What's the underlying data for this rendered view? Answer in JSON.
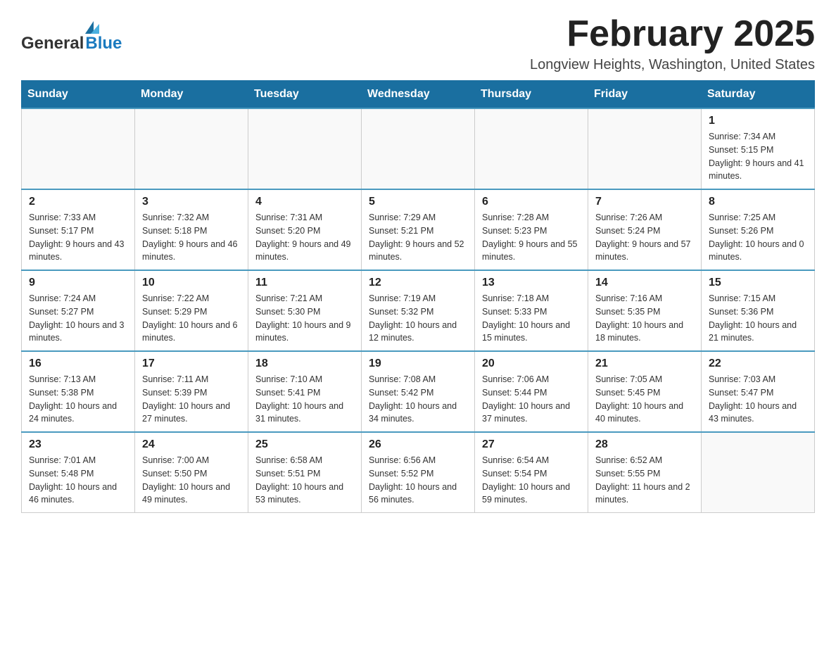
{
  "header": {
    "logo_general": "General",
    "logo_blue": "Blue",
    "month_title": "February 2025",
    "location": "Longview Heights, Washington, United States"
  },
  "calendar": {
    "days_of_week": [
      "Sunday",
      "Monday",
      "Tuesday",
      "Wednesday",
      "Thursday",
      "Friday",
      "Saturday"
    ],
    "weeks": [
      [
        {
          "day": "",
          "info": ""
        },
        {
          "day": "",
          "info": ""
        },
        {
          "day": "",
          "info": ""
        },
        {
          "day": "",
          "info": ""
        },
        {
          "day": "",
          "info": ""
        },
        {
          "day": "",
          "info": ""
        },
        {
          "day": "1",
          "info": "Sunrise: 7:34 AM\nSunset: 5:15 PM\nDaylight: 9 hours and 41 minutes."
        }
      ],
      [
        {
          "day": "2",
          "info": "Sunrise: 7:33 AM\nSunset: 5:17 PM\nDaylight: 9 hours and 43 minutes."
        },
        {
          "day": "3",
          "info": "Sunrise: 7:32 AM\nSunset: 5:18 PM\nDaylight: 9 hours and 46 minutes."
        },
        {
          "day": "4",
          "info": "Sunrise: 7:31 AM\nSunset: 5:20 PM\nDaylight: 9 hours and 49 minutes."
        },
        {
          "day": "5",
          "info": "Sunrise: 7:29 AM\nSunset: 5:21 PM\nDaylight: 9 hours and 52 minutes."
        },
        {
          "day": "6",
          "info": "Sunrise: 7:28 AM\nSunset: 5:23 PM\nDaylight: 9 hours and 55 minutes."
        },
        {
          "day": "7",
          "info": "Sunrise: 7:26 AM\nSunset: 5:24 PM\nDaylight: 9 hours and 57 minutes."
        },
        {
          "day": "8",
          "info": "Sunrise: 7:25 AM\nSunset: 5:26 PM\nDaylight: 10 hours and 0 minutes."
        }
      ],
      [
        {
          "day": "9",
          "info": "Sunrise: 7:24 AM\nSunset: 5:27 PM\nDaylight: 10 hours and 3 minutes."
        },
        {
          "day": "10",
          "info": "Sunrise: 7:22 AM\nSunset: 5:29 PM\nDaylight: 10 hours and 6 minutes."
        },
        {
          "day": "11",
          "info": "Sunrise: 7:21 AM\nSunset: 5:30 PM\nDaylight: 10 hours and 9 minutes."
        },
        {
          "day": "12",
          "info": "Sunrise: 7:19 AM\nSunset: 5:32 PM\nDaylight: 10 hours and 12 minutes."
        },
        {
          "day": "13",
          "info": "Sunrise: 7:18 AM\nSunset: 5:33 PM\nDaylight: 10 hours and 15 minutes."
        },
        {
          "day": "14",
          "info": "Sunrise: 7:16 AM\nSunset: 5:35 PM\nDaylight: 10 hours and 18 minutes."
        },
        {
          "day": "15",
          "info": "Sunrise: 7:15 AM\nSunset: 5:36 PM\nDaylight: 10 hours and 21 minutes."
        }
      ],
      [
        {
          "day": "16",
          "info": "Sunrise: 7:13 AM\nSunset: 5:38 PM\nDaylight: 10 hours and 24 minutes."
        },
        {
          "day": "17",
          "info": "Sunrise: 7:11 AM\nSunset: 5:39 PM\nDaylight: 10 hours and 27 minutes."
        },
        {
          "day": "18",
          "info": "Sunrise: 7:10 AM\nSunset: 5:41 PM\nDaylight: 10 hours and 31 minutes."
        },
        {
          "day": "19",
          "info": "Sunrise: 7:08 AM\nSunset: 5:42 PM\nDaylight: 10 hours and 34 minutes."
        },
        {
          "day": "20",
          "info": "Sunrise: 7:06 AM\nSunset: 5:44 PM\nDaylight: 10 hours and 37 minutes."
        },
        {
          "day": "21",
          "info": "Sunrise: 7:05 AM\nSunset: 5:45 PM\nDaylight: 10 hours and 40 minutes."
        },
        {
          "day": "22",
          "info": "Sunrise: 7:03 AM\nSunset: 5:47 PM\nDaylight: 10 hours and 43 minutes."
        }
      ],
      [
        {
          "day": "23",
          "info": "Sunrise: 7:01 AM\nSunset: 5:48 PM\nDaylight: 10 hours and 46 minutes."
        },
        {
          "day": "24",
          "info": "Sunrise: 7:00 AM\nSunset: 5:50 PM\nDaylight: 10 hours and 49 minutes."
        },
        {
          "day": "25",
          "info": "Sunrise: 6:58 AM\nSunset: 5:51 PM\nDaylight: 10 hours and 53 minutes."
        },
        {
          "day": "26",
          "info": "Sunrise: 6:56 AM\nSunset: 5:52 PM\nDaylight: 10 hours and 56 minutes."
        },
        {
          "day": "27",
          "info": "Sunrise: 6:54 AM\nSunset: 5:54 PM\nDaylight: 10 hours and 59 minutes."
        },
        {
          "day": "28",
          "info": "Sunrise: 6:52 AM\nSunset: 5:55 PM\nDaylight: 11 hours and 2 minutes."
        },
        {
          "day": "",
          "info": ""
        }
      ]
    ]
  }
}
